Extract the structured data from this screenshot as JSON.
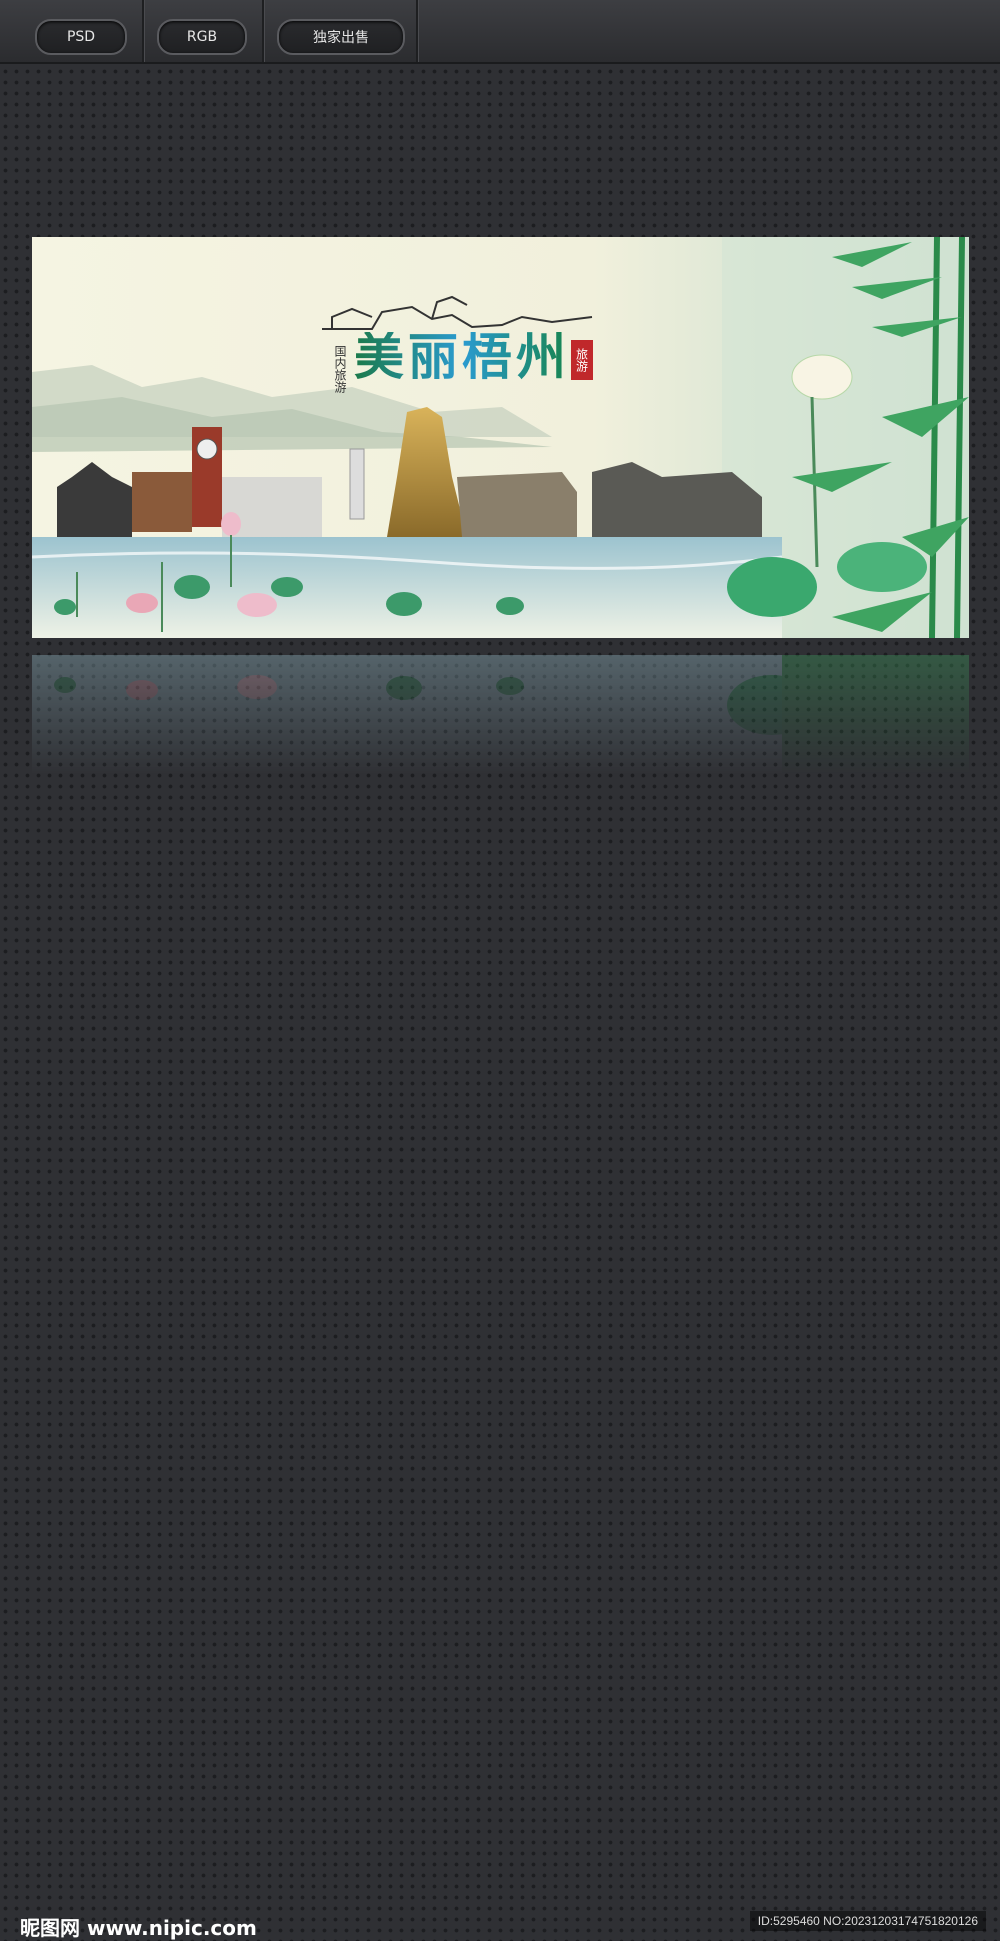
{
  "toolbar": {
    "format_label": "PSD",
    "color_mode_label": "RGB",
    "exclusive_label": "独家出售"
  },
  "banner": {
    "title": "美丽梧州",
    "vertical_tag": "国内旅游",
    "stamp_text": "旅游"
  },
  "footer": {
    "logo_text": "昵图网 www.nipic.com",
    "id_text": "ID:5295460 NO:20231203174751820126"
  },
  "colors": {
    "page_bg": "#2f3034",
    "title_green": "#1c7a4a",
    "title_blue": "#2a9bd0",
    "stamp_red": "#c0282b"
  }
}
